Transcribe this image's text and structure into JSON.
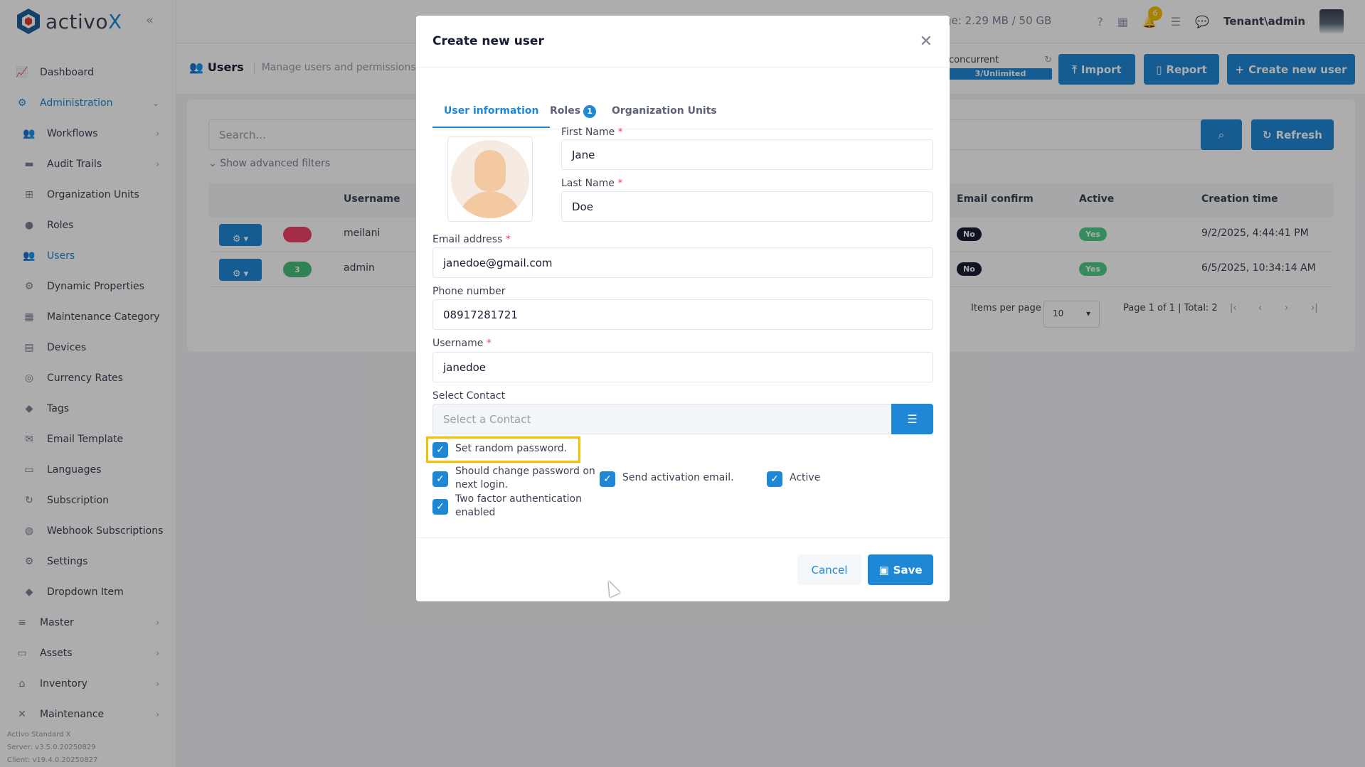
{
  "app": {
    "logo_prefix": "activo",
    "logo_suffix": "X"
  },
  "sidebar": {
    "items": [
      {
        "label": "Dashboard",
        "icon": "chart-icon"
      },
      {
        "label": "Administration",
        "icon": "cogs-icon"
      },
      {
        "label": "Workflows",
        "icon": "users-icon"
      },
      {
        "label": "Audit Trails",
        "icon": "folder-icon"
      },
      {
        "label": "Organization Units",
        "icon": "sitemap-icon"
      },
      {
        "label": "Roles",
        "icon": "user-icon"
      },
      {
        "label": "Users",
        "icon": "users-icon"
      },
      {
        "label": "Dynamic Properties",
        "icon": "gear-icon"
      },
      {
        "label": "Maintenance Category",
        "icon": "grid-icon"
      },
      {
        "label": "Devices",
        "icon": "printer-icon"
      },
      {
        "label": "Currency Rates",
        "icon": "coins-icon"
      },
      {
        "label": "Tags",
        "icon": "tag-icon"
      },
      {
        "label": "Email Template",
        "icon": "envelope-icon"
      },
      {
        "label": "Languages",
        "icon": "language-icon"
      },
      {
        "label": "Subscription",
        "icon": "sync-icon"
      },
      {
        "label": "Webhook Subscriptions",
        "icon": "globe-icon"
      },
      {
        "label": "Settings",
        "icon": "gear-icon"
      },
      {
        "label": "Dropdown Item",
        "icon": "tags-icon"
      },
      {
        "label": "Master",
        "icon": "database-icon"
      },
      {
        "label": "Assets",
        "icon": "laptop-icon"
      },
      {
        "label": "Inventory",
        "icon": "warehouse-icon"
      },
      {
        "label": "Maintenance",
        "icon": "tools-icon"
      }
    ],
    "footer": {
      "edition": "Activo Standard X",
      "server": "Server: v3.5.0.20250829",
      "client": "Client: v19.4.0.20250827"
    }
  },
  "topbar": {
    "storage": "ge: 2.29 MB / 50 GB",
    "notification_count": "6",
    "tenant": "Tenant\\admin"
  },
  "subheader": {
    "title": "Users",
    "description": "Manage users and permissions.",
    "concurrent_label": "concurrent",
    "concurrent_value": "3/Unlimited",
    "import_label": "Import",
    "report_label": "Report",
    "create_label": "Create new user"
  },
  "list": {
    "search_placeholder": "Search...",
    "refresh_label": "Refresh",
    "advanced_filters": "Show advanced filters",
    "columns": {
      "username": "Username",
      "email_confirm": "Email confirm",
      "active": "Active",
      "creation_time": "Creation time"
    },
    "rows": [
      {
        "pill": "",
        "pill_color": "#f1416c",
        "username": "meilani",
        "email_confirm": "No",
        "active": "Yes",
        "creation_time": "9/2/2025, 4:44:41 PM"
      },
      {
        "pill": "3",
        "pill_color": "#47be7d",
        "username": "admin",
        "email_confirm": "No",
        "active": "Yes",
        "creation_time": "6/5/2025, 10:34:14 AM"
      }
    ],
    "items_per_page_label": "Items per page",
    "items_per_page": "10",
    "page_info": "Page 1 of 1 | Total: 2"
  },
  "modal": {
    "title": "Create new user",
    "tabs": [
      {
        "label": "User information"
      },
      {
        "label": "Roles",
        "badge": "1"
      },
      {
        "label": "Organization Units"
      }
    ],
    "first_name_label": "First Name",
    "first_name": "Jane",
    "last_name_label": "Last Name",
    "last_name": "Doe",
    "email_label": "Email address",
    "email": "janedoe@gmail.com",
    "phone_label": "Phone number",
    "phone": "08917281721",
    "username_label": "Username",
    "username": "janedoe",
    "contact_label": "Select Contact",
    "contact_placeholder": "Select a Contact",
    "checkboxes": {
      "random_password": "Set random password.",
      "change_password_1": "Should change password on",
      "change_password_2": "next login.",
      "send_activation": "Send activation email.",
      "active": "Active",
      "two_factor_1": "Two factor authentication",
      "two_factor_2": "enabled"
    },
    "cancel_label": "Cancel",
    "save_label": "Save"
  },
  "colors": {
    "primary": "#1e88d6",
    "highlight": "#f6c000",
    "danger": "#f1416c",
    "success": "#50cd89"
  }
}
